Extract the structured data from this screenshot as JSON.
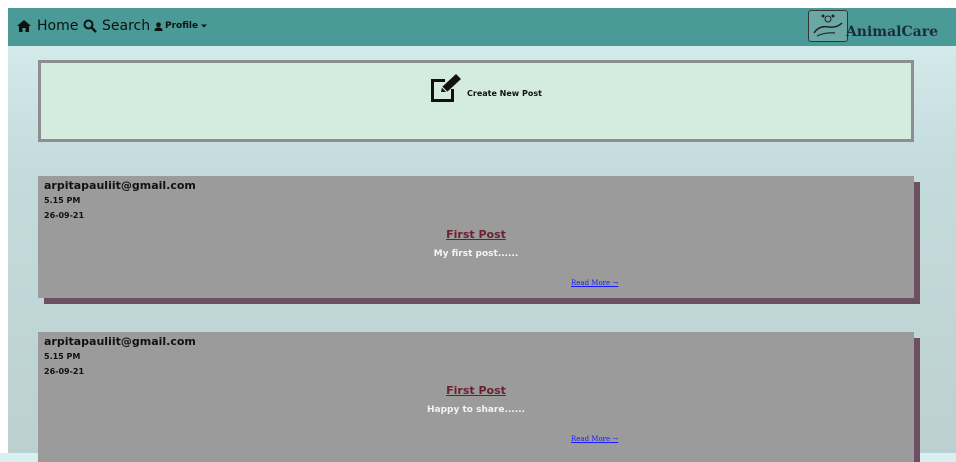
{
  "nav": {
    "home_label": "Home",
    "search_label": "Search",
    "profile_label": "Profile",
    "brand": "AnimalCare",
    "colors": {
      "navbar": "#4a9a98"
    }
  },
  "create": {
    "label": "Create New Post"
  },
  "posts": [
    {
      "author": "arpitapauliit@gmail.com",
      "time": "5.15 PM",
      "date": "26-09-21",
      "title": "First Post",
      "excerpt": "My first post......",
      "read_more": "Read More →"
    },
    {
      "author": "arpitapauliit@gmail.com",
      "time": "5.15 PM",
      "date": "26-09-21",
      "title": "First Post",
      "excerpt": "Happy to share......",
      "read_more": "Read More →"
    }
  ],
  "icons": {
    "home": "home-icon",
    "search": "search-icon",
    "profile": "user-icon",
    "dropdown": "caret-down-icon",
    "create": "edit-icon"
  }
}
